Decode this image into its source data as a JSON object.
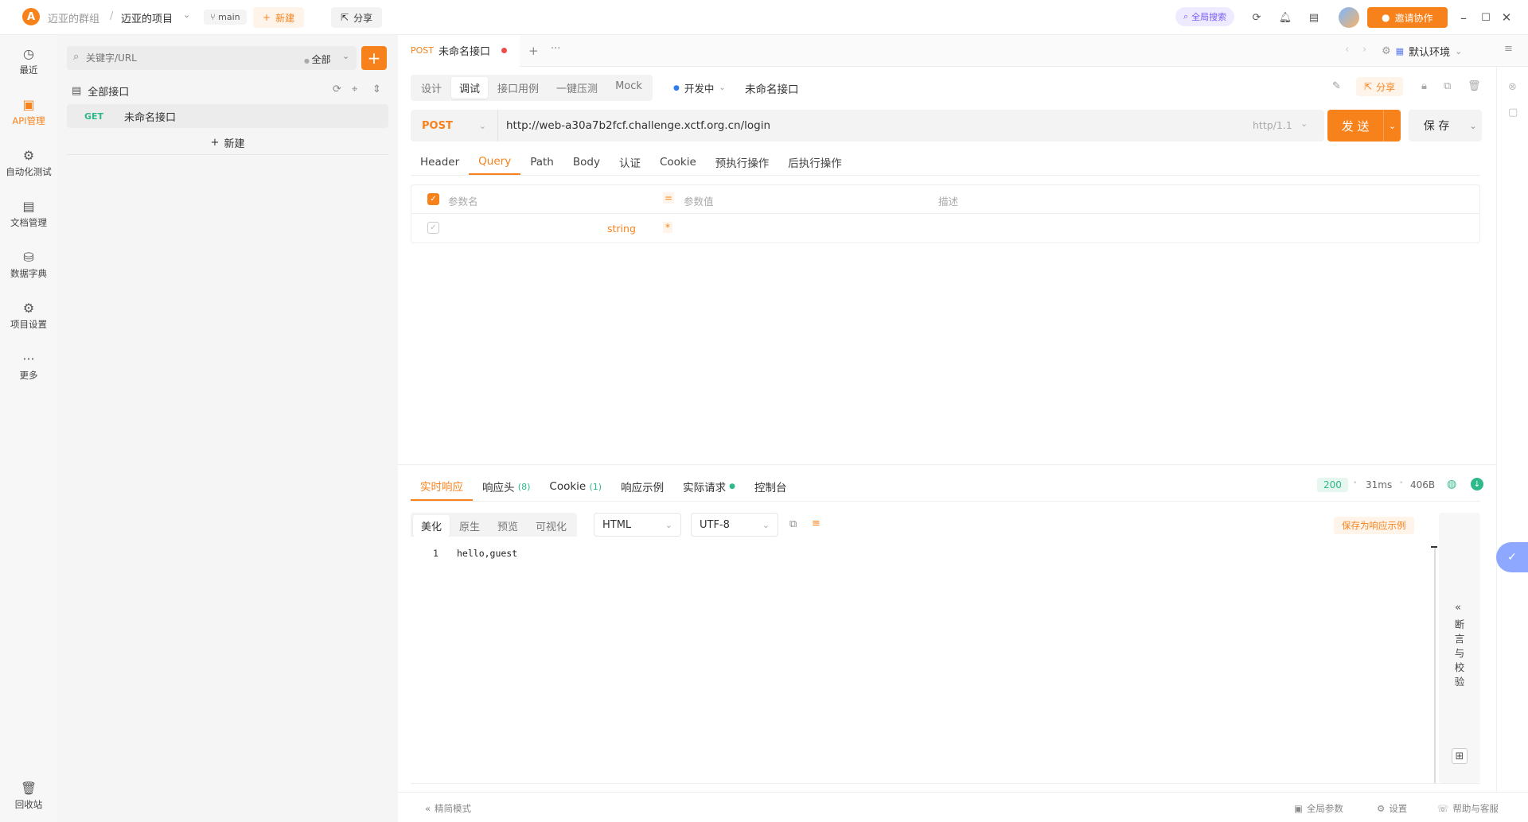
{
  "topbar": {
    "team": "迈亚的群组",
    "sep": "/",
    "project": "迈亚的项目",
    "branch": "main",
    "new_label": "新建",
    "share_label": "分享",
    "global_search": "全局搜索",
    "invite_label": "邀请协作"
  },
  "nav": [
    {
      "label": "最近",
      "icon": "clock-icon",
      "glyph": "◷"
    },
    {
      "label": "API管理",
      "icon": "api-icon",
      "glyph": "▣"
    },
    {
      "label": "自动化测试",
      "icon": "automation-icon",
      "glyph": "⚙"
    },
    {
      "label": "文档管理",
      "icon": "document-icon",
      "glyph": "▤"
    },
    {
      "label": "数据字典",
      "icon": "dictionary-icon",
      "glyph": "⛁"
    },
    {
      "label": "项目设置",
      "icon": "settings-icon",
      "glyph": "⚙"
    },
    {
      "label": "更多",
      "icon": "more-icon",
      "glyph": "···"
    }
  ],
  "trash_label": "回收站",
  "tree": {
    "search_placeholder": "关键字/URL",
    "filter": "全部",
    "root": "全部接口",
    "item_method": "GET",
    "item_name": "未命名接口",
    "new_label": "新建"
  },
  "tab": {
    "method": "POST",
    "name": "未命名接口"
  },
  "env": "默认环境",
  "modes": [
    "设计",
    "调试",
    "接口用例",
    "一键压测",
    "Mock"
  ],
  "status": "开发中",
  "api_title": "未命名接口",
  "share2": "分享",
  "request": {
    "method": "POST",
    "url": "http://web-a30a7b2fcf.challenge.xctf.org.cn/login",
    "protocol": "http/1.1",
    "send": "发 送",
    "save": "保 存"
  },
  "req_tabs": [
    "Header",
    "Query",
    "Path",
    "Body",
    "认证",
    "Cookie",
    "预执行操作",
    "后执行操作"
  ],
  "params": {
    "col_name": "参数名",
    "col_value": "参数值",
    "col_desc": "描述",
    "row_type": "string",
    "row_required": "*"
  },
  "resp_tabs": {
    "realtime": "实时响应",
    "headers": "响应头",
    "headers_count": "(8)",
    "cookie": "Cookie",
    "cookie_count": "(1)",
    "example": "响应示例",
    "actual": "实际请求",
    "console": "控制台"
  },
  "resp_meta": {
    "code": "200",
    "time": "31ms",
    "size": "406B"
  },
  "view_modes": [
    "美化",
    "原生",
    "预览",
    "可视化"
  ],
  "format": "HTML",
  "encoding": "UTF-8",
  "save_example": "保存为响应示例",
  "code": {
    "line_no": "1",
    "content": "hello,guest"
  },
  "side_panel": {
    "chars": [
      "断",
      "言",
      "与",
      "校",
      "验"
    ]
  },
  "footer": {
    "compact": "精简模式",
    "global_params": "全局参数",
    "settings": "设置",
    "help": "帮助与客服"
  },
  "colors": {
    "accent": "#f7821b",
    "status_ok": "#2fb88a"
  }
}
